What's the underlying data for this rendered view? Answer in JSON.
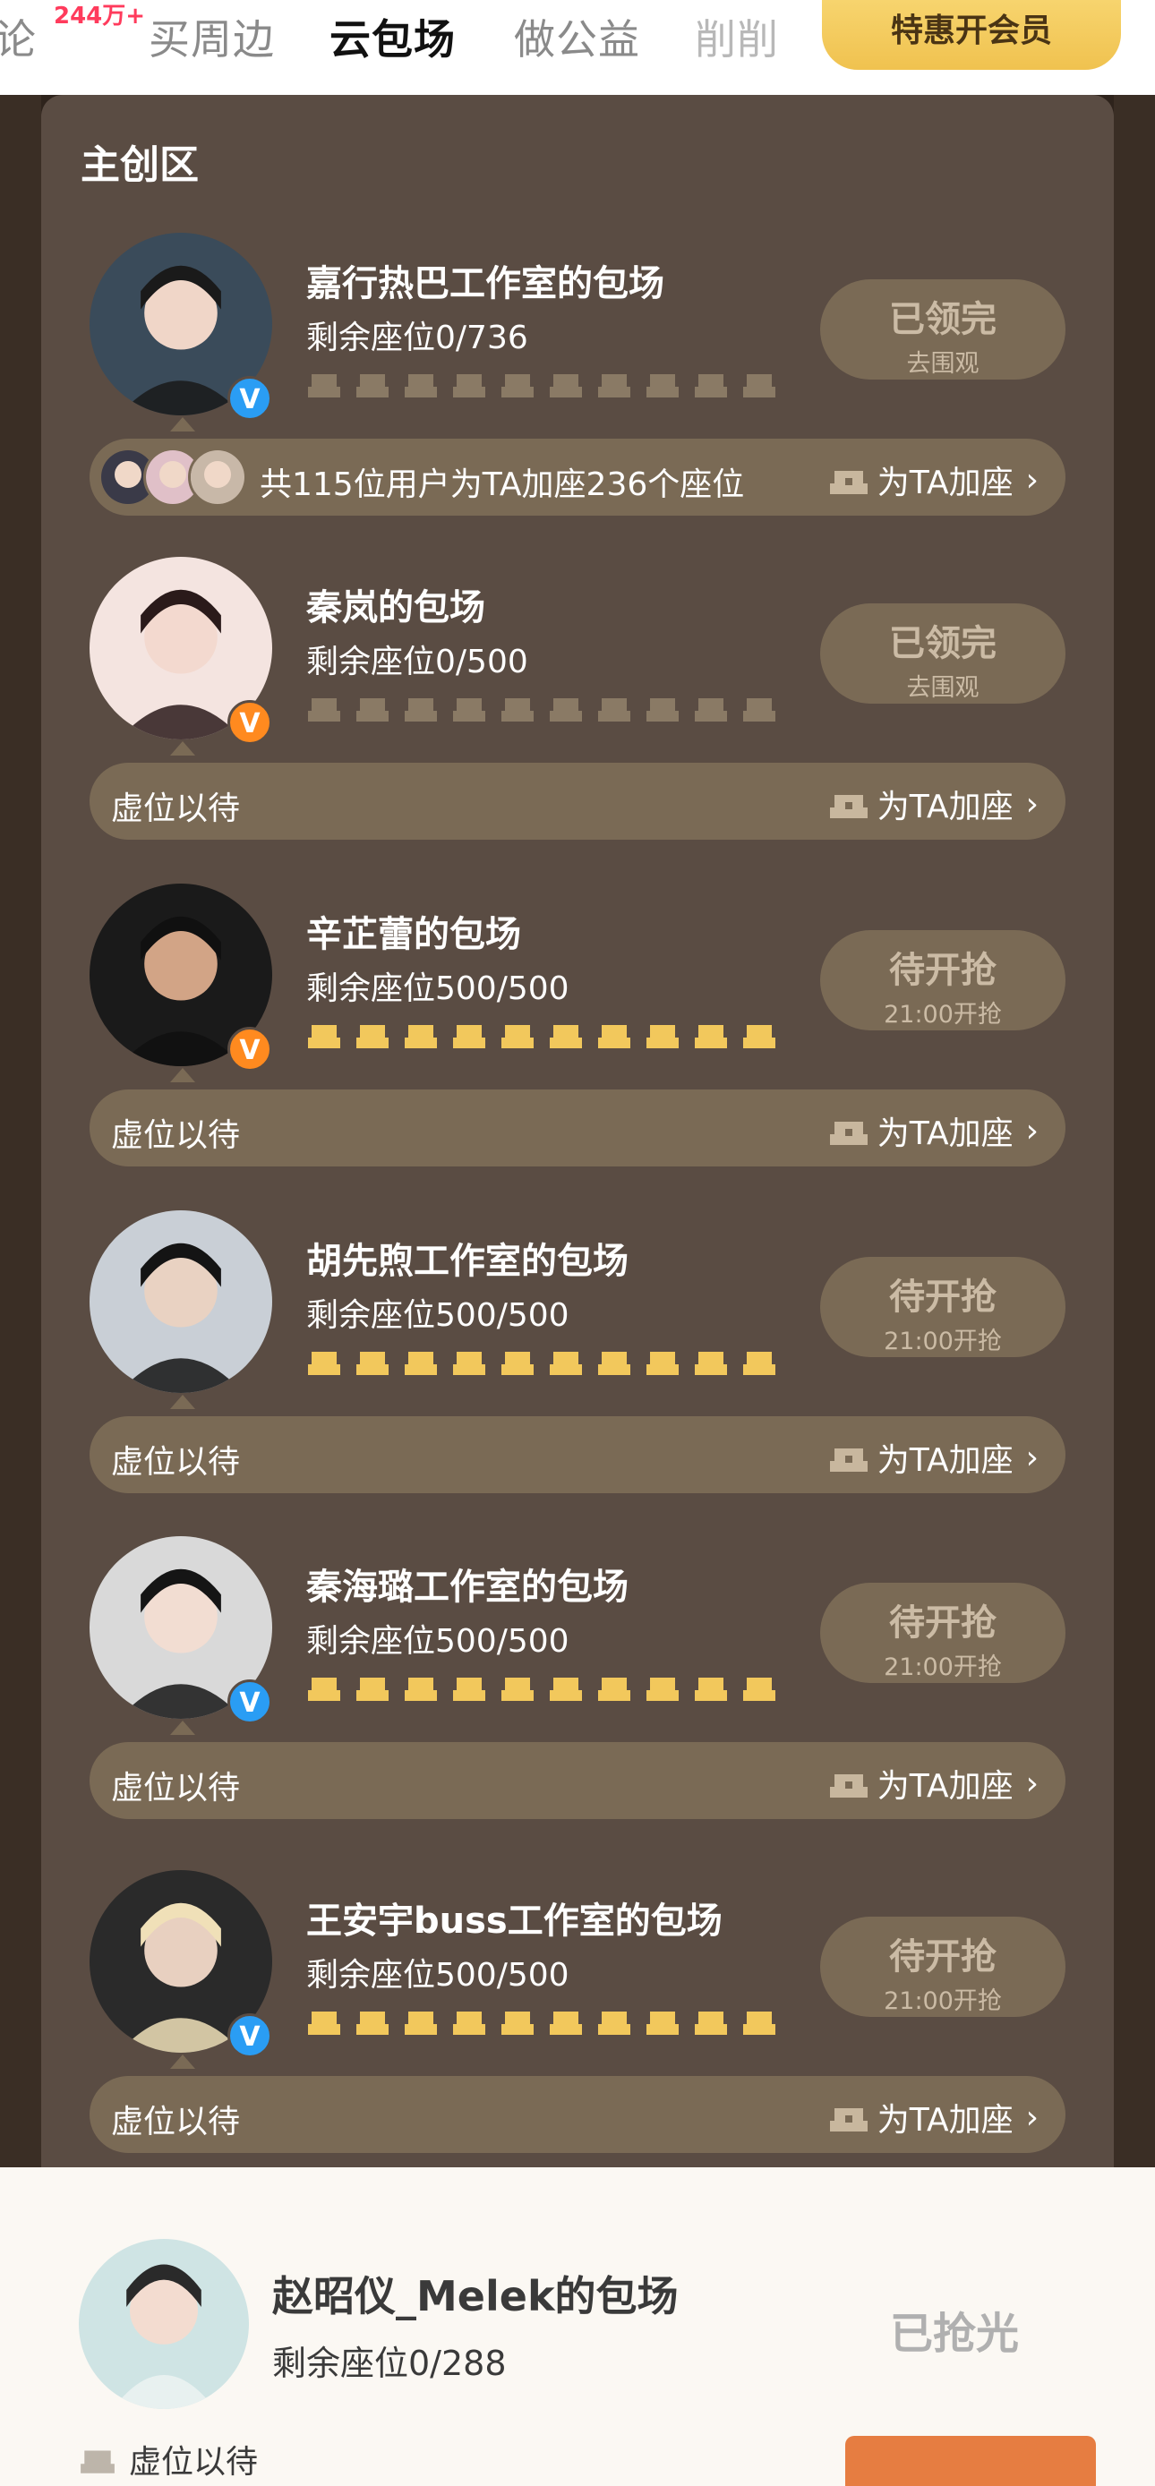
{
  "top_nav": {
    "tabs": [
      "论",
      "买周边",
      "云包场",
      "做公益",
      "削削"
    ],
    "active_tab": "云包场",
    "badge": "244万+",
    "vip_button": "特惠开会员"
  },
  "section": {
    "title": "主创区"
  },
  "cards": [
    {
      "name": "嘉行热巴工作室的包场",
      "seats": "剩余座位0/736",
      "status_main": "已领完",
      "status_sub": "去围观",
      "bar_text": "共115位用户为TA加座236个座位",
      "bar_action": "为TA加座",
      "verified": "blue",
      "seats_available": 0,
      "chairs_shown": 10
    },
    {
      "name": "秦岚的包场",
      "seats": "剩余座位0/500",
      "status_main": "已领完",
      "status_sub": "去围观",
      "bar_text": "虚位以待",
      "bar_action": "为TA加座",
      "verified": "orange",
      "seats_available": 0,
      "chairs_shown": 10
    },
    {
      "name": "辛芷蕾的包场",
      "seats": "剩余座位500/500",
      "status_main": "待开抢",
      "status_sub": "21:00开抢",
      "bar_text": "虚位以待",
      "bar_action": "为TA加座",
      "verified": "orange",
      "seats_available": 500,
      "chairs_shown": 10
    },
    {
      "name": "胡先煦工作室的包场",
      "seats": "剩余座位500/500",
      "status_main": "待开抢",
      "status_sub": "21:00开抢",
      "bar_text": "虚位以待",
      "bar_action": "为TA加座",
      "verified": "none",
      "seats_available": 500,
      "chairs_shown": 10
    },
    {
      "name": "秦海璐工作室的包场",
      "seats": "剩余座位500/500",
      "status_main": "待开抢",
      "status_sub": "21:00开抢",
      "bar_text": "虚位以待",
      "bar_action": "为TA加座",
      "verified": "blue",
      "seats_available": 500,
      "chairs_shown": 10
    },
    {
      "name": "王安宇buss工作室的包场",
      "seats": "剩余座位500/500",
      "status_main": "待开抢",
      "status_sub": "21:00开抢",
      "bar_text": "虚位以待",
      "bar_action": "为TA加座",
      "verified": "blue",
      "seats_available": 500,
      "chairs_shown": 10
    }
  ],
  "bottom_card": {
    "name": "赵昭仪_Melek的包场",
    "seats": "剩余座位0/288",
    "status": "已抢光",
    "bar_text": "虚位以待"
  },
  "colors": {
    "panel": "#5a4c43",
    "pill": "#7a6a55",
    "chair_active": "#f2c85c",
    "chair_inactive": "#8a7a65",
    "vip_gold": "#f0c24f"
  }
}
